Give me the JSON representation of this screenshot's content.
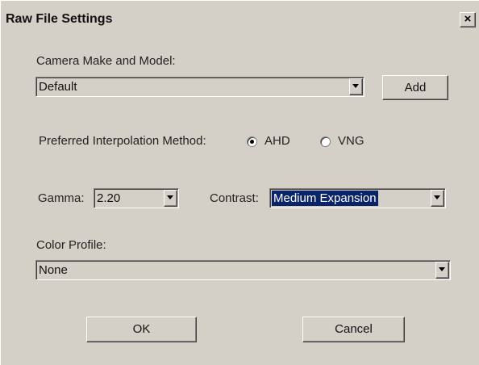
{
  "window": {
    "title": "Raw File Settings",
    "close_label": "×"
  },
  "camera": {
    "label": "Camera Make and Model:",
    "value": "Default",
    "add_label": "Add"
  },
  "interpolation": {
    "label": "Preferred Interpolation Method:",
    "options": [
      {
        "label": "AHD",
        "checked": true
      },
      {
        "label": "VNG",
        "checked": false
      }
    ]
  },
  "gamma": {
    "label": "Gamma:",
    "value": "2.20"
  },
  "contrast": {
    "label": "Contrast:",
    "value": "Medium Expansion"
  },
  "color_profile": {
    "label": "Color Profile:",
    "value": "None"
  },
  "buttons": {
    "ok_label": "OK",
    "cancel_label": "Cancel"
  },
  "colors": {
    "dialog_bg": "#d4d0c8",
    "selection_bg": "#0a246a"
  },
  "icons": [
    "close-icon",
    "dropdown-arrow-icon",
    "radio-icon"
  ]
}
